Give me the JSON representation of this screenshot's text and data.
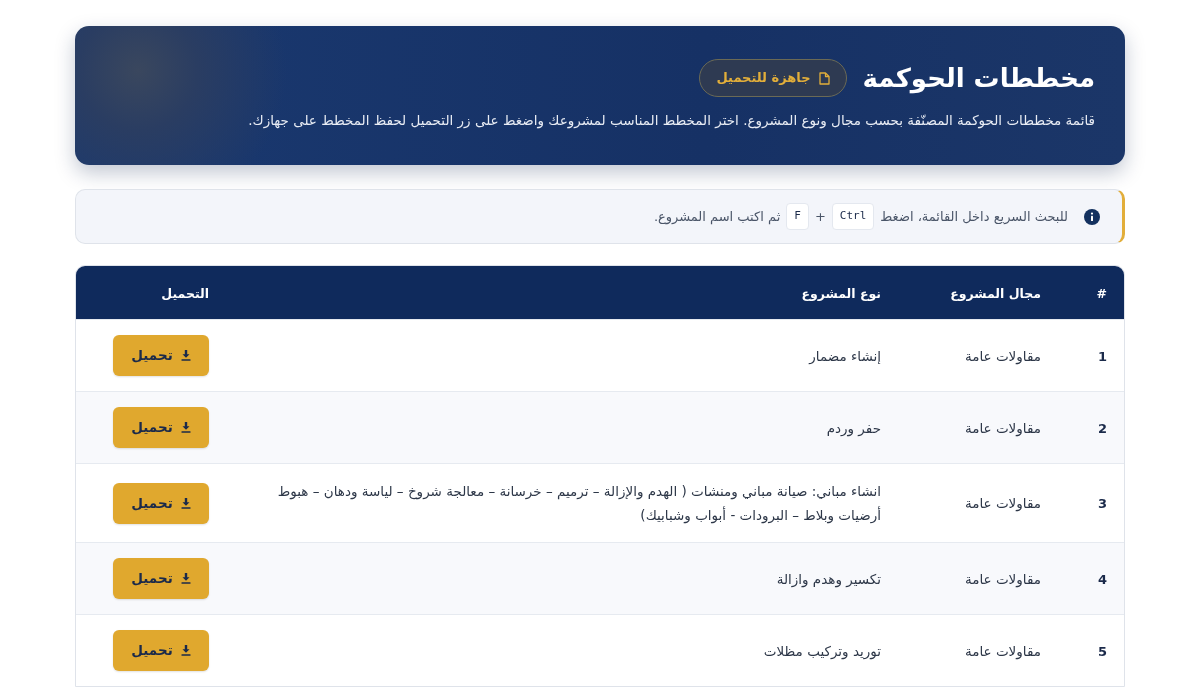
{
  "header": {
    "title": "مخططات الحوكمة",
    "badge": "جاهزة للتحميل",
    "description": "قائمة مخططات الحوكمة المصنّفة بحسب مجال ونوع المشروع. اختر المخطط المناسب لمشروعك واضغط على زر التحميل لحفظ المخطط على جهازك."
  },
  "tip": {
    "text_before": "للبحث السريع داخل القائمة، اضغط",
    "keys": [
      "Ctrl",
      "F"
    ],
    "joiner": "+",
    "text_after": "ثم اكتب اسم المشروع."
  },
  "table": {
    "columns": [
      "#",
      "مجال المشروع",
      "نوع المشروع",
      "التحميل"
    ],
    "rows": [
      {
        "number": "1",
        "field": "مقاولات عامة",
        "type": "إنشاء مضمار",
        "action": "تحميل"
      },
      {
        "number": "2",
        "field": "مقاولات عامة",
        "type": "حفر وردم",
        "action": "تحميل"
      },
      {
        "number": "3",
        "field": "مقاولات عامة",
        "type": "انشاء مباني: صيانة مباني ومنشات ( الهدم والإزالة – ترميم – خرسانة – معالجة شروخ – لياسة ودهان – هبوط أرضيات وبلاط – البرودات - أبواب وشبابيك)",
        "action": "تحميل"
      },
      {
        "number": "4",
        "field": "مقاولات عامة",
        "type": "تكسير وهدم وازالة",
        "action": "تحميل"
      },
      {
        "number": "5",
        "field": "مقاولات عامة",
        "type": "توريد وتركيب مظلات",
        "action": "تحميل"
      }
    ]
  }
}
